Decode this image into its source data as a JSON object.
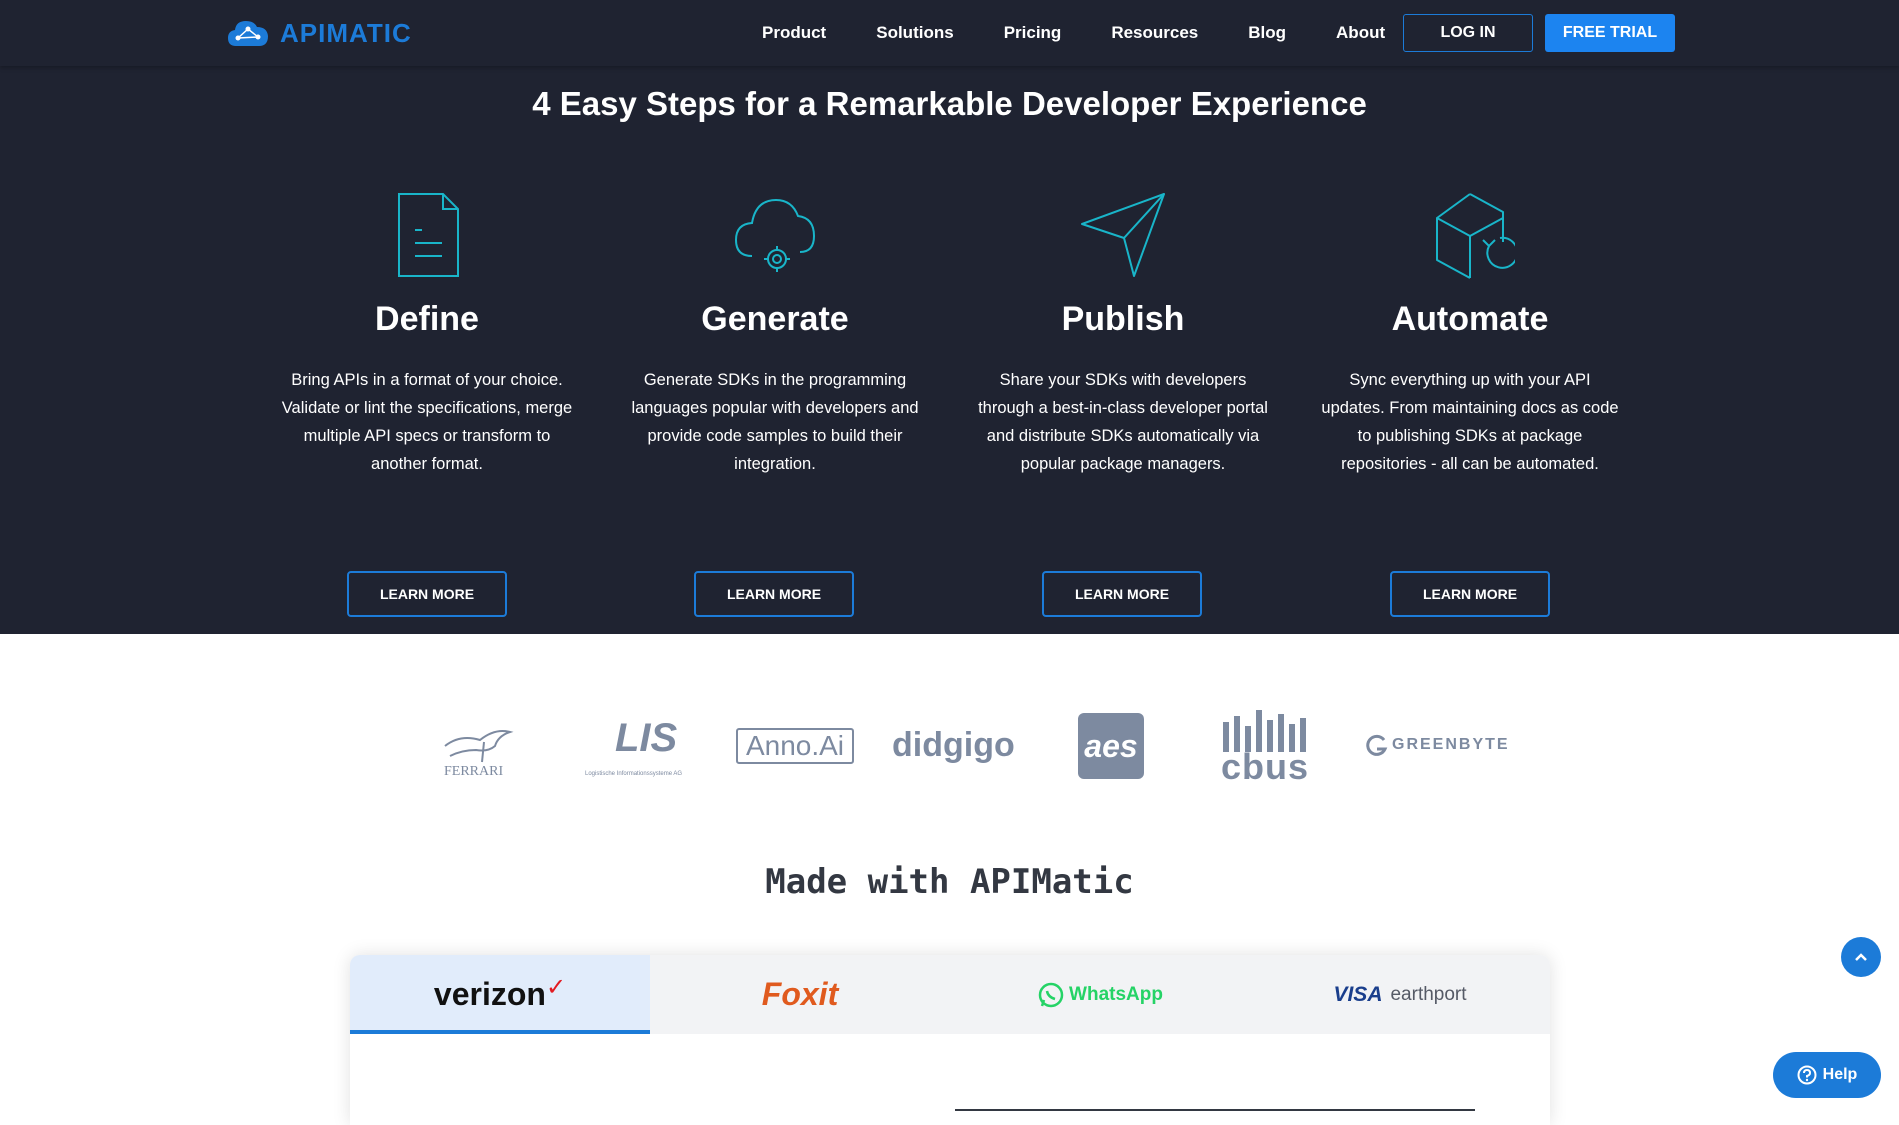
{
  "nav": {
    "logo_text": "APIMATIC",
    "links": [
      "Product",
      "Solutions",
      "Pricing",
      "Resources",
      "Blog",
      "About"
    ],
    "login_label": "LOG IN",
    "trial_label": "FREE TRIAL"
  },
  "hero": {
    "title": "4 Easy Steps for a Remarkable Developer Experience",
    "steps": [
      {
        "icon": "document-icon",
        "title": "Define",
        "description": "Bring APIs in a format of your choice. Validate or lint the specifications, merge multiple API specs or transform to another format.",
        "button": "LEARN MORE"
      },
      {
        "icon": "cloud-gear-icon",
        "title": "Generate",
        "description": "Generate SDKs in the programming languages popular with developers and provide code samples to build their integration.",
        "button": "LEARN MORE"
      },
      {
        "icon": "paper-plane-icon",
        "title": "Publish",
        "description": "Share your SDKs with developers through a best-in-class developer portal and distribute SDKs automatically via popular package managers.",
        "button": "LEARN MORE"
      },
      {
        "icon": "cube-refresh-icon",
        "title": "Automate",
        "description": "Sync everything up with your API updates. From maintaining docs as code to publishing SDKs at package repositories - all can be automated.",
        "button": "LEARN MORE"
      }
    ]
  },
  "clients": {
    "logos": [
      "FERRARI",
      "LIS",
      "Logistische Informationssysteme AG",
      "Anno.Ai",
      "didgigo",
      "aes",
      "cbus",
      "GREENBYTE"
    ]
  },
  "made_with": {
    "title": "Made with APIMatic",
    "tabs": [
      "verizon",
      "Foxit",
      "WhatsApp",
      "VISA",
      "earthport"
    ]
  },
  "widgets": {
    "help_label": "Help",
    "accent": "#1c7bd8",
    "background_dark": "#1f2331"
  }
}
